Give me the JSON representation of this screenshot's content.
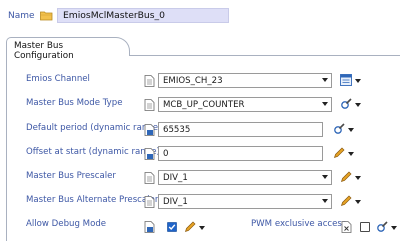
{
  "header": {
    "name_label": "Name",
    "name_value": "EmiosMclMasterBus_0"
  },
  "tab": {
    "label": "Master Bus Configuration"
  },
  "fields": [
    {
      "label": "Emios Channel",
      "value": "EMIOS_CH_23",
      "kind": "combo"
    },
    {
      "label": "Master Bus Mode Type",
      "value": "MCB_UP_COUNTER",
      "kind": "combo"
    },
    {
      "label": "Default period (dynamic range)",
      "value": "65535",
      "kind": "text"
    },
    {
      "label": "Offset at start (dynamic range)",
      "value": "0",
      "kind": "text"
    },
    {
      "label": "Master Bus Prescaler",
      "value": "DIV_1",
      "kind": "combo"
    },
    {
      "label": "Master Bus Alternate Prescaler",
      "value": "DIV_1",
      "kind": "combo"
    }
  ],
  "debug": {
    "label": "Allow Debug Mode",
    "checked": true
  },
  "pwm": {
    "label": "PWM exclusive access",
    "checked": false
  },
  "colors": {
    "label_blue": "#3d57a5",
    "name_field_bg": "#dedff7",
    "checkbox_checked": "#1f64c9"
  }
}
